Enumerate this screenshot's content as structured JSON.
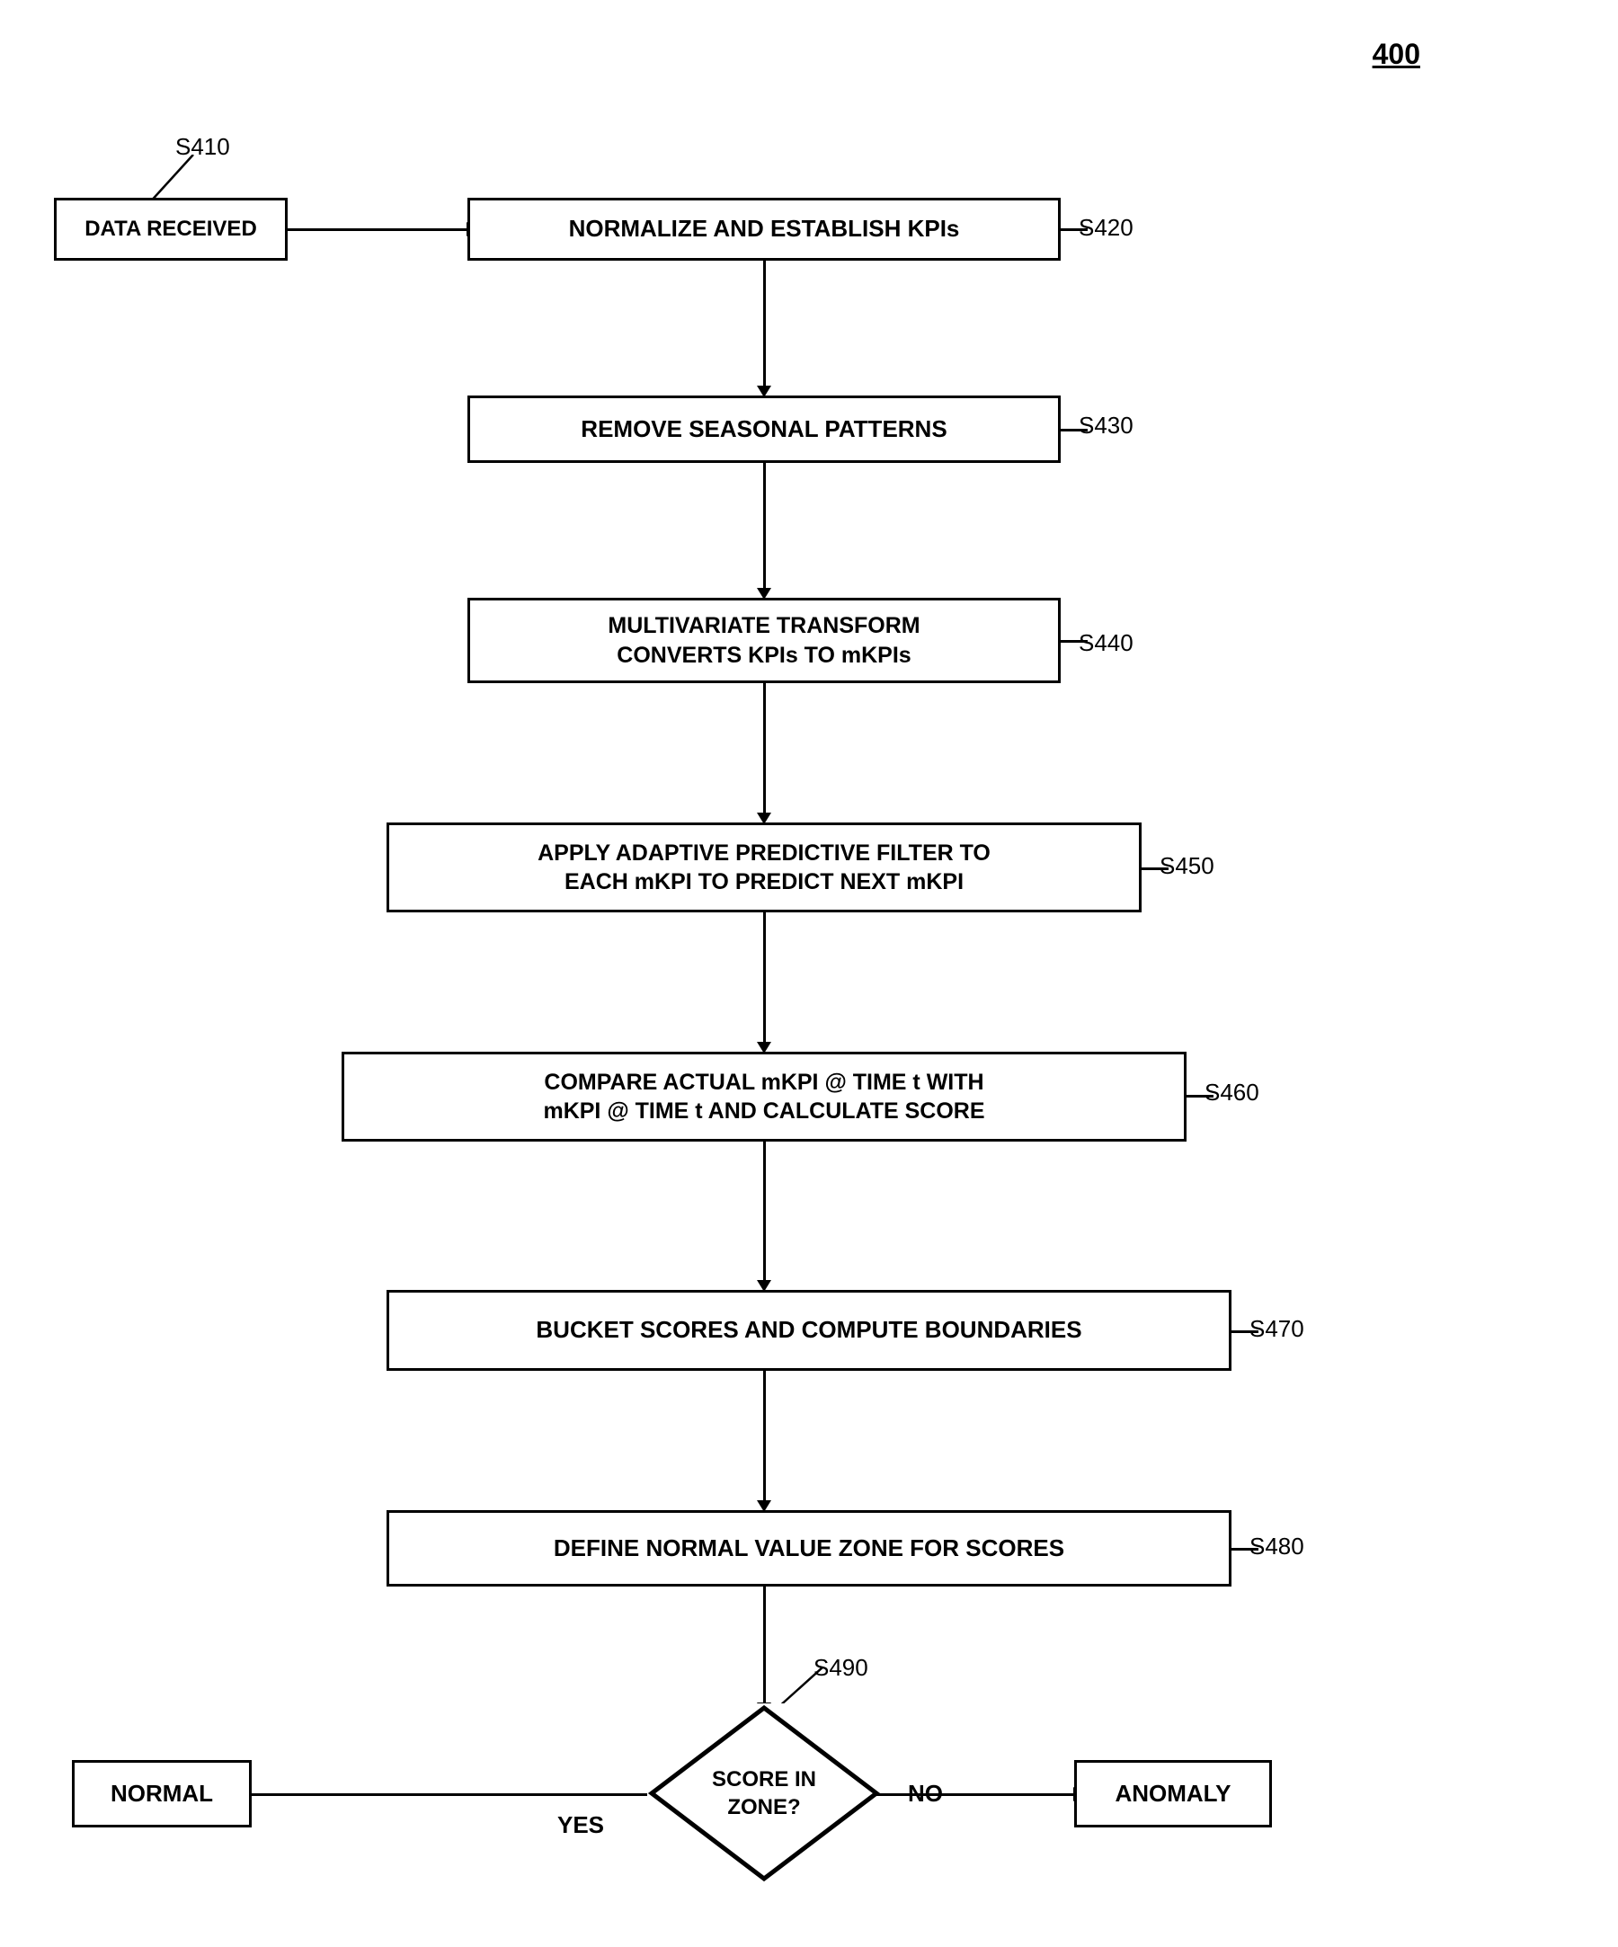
{
  "figure": {
    "number": "400",
    "steps": [
      {
        "id": "s410",
        "label": "S410"
      },
      {
        "id": "data-received",
        "label": "DATA RECEIVED"
      },
      {
        "id": "s420",
        "label": "S420"
      },
      {
        "id": "normalize",
        "label": "NORMALIZE AND ESTABLISH KPIs"
      },
      {
        "id": "s430",
        "label": "S430"
      },
      {
        "id": "remove-seasonal",
        "label": "REMOVE SEASONAL PATTERNS"
      },
      {
        "id": "s440",
        "label": "S440"
      },
      {
        "id": "multivariate",
        "label": "MULTIVARIATE TRANSFORM\nCONVERTS KPIs TO mKPIs"
      },
      {
        "id": "s450",
        "label": "S450"
      },
      {
        "id": "apply-filter",
        "label": "APPLY ADAPTIVE PREDICTIVE FILTER TO\nEACH mKPI TO PREDICT NEXT mKPI"
      },
      {
        "id": "s460",
        "label": "S460"
      },
      {
        "id": "compare",
        "label": "COMPARE ACTUAL mKPI @ TIME t WITH\nmKPI @ TIME t AND CALCULATE SCORE"
      },
      {
        "id": "s470",
        "label": "S470"
      },
      {
        "id": "bucket-scores",
        "label": "BUCKET SCORES AND COMPUTE BOUNDARIES"
      },
      {
        "id": "s480",
        "label": "S480"
      },
      {
        "id": "define-normal",
        "label": "DEFINE NORMAL VALUE ZONE FOR SCORES"
      },
      {
        "id": "s490",
        "label": "S490"
      },
      {
        "id": "decision",
        "label": "SCORE IN\nZONE?"
      },
      {
        "id": "yes-label",
        "label": "YES"
      },
      {
        "id": "no-label",
        "label": "NO"
      },
      {
        "id": "normal",
        "label": "NORMAL"
      },
      {
        "id": "anomaly",
        "label": "ANOMALY"
      }
    ]
  }
}
